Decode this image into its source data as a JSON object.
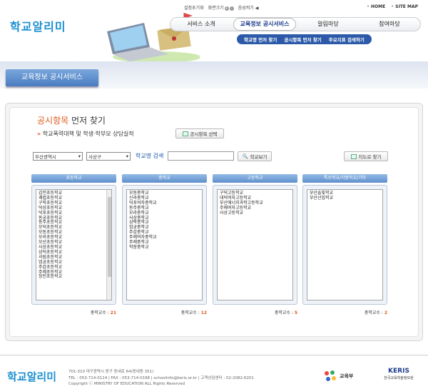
{
  "header": {
    "logo": "학교알리미",
    "util": {
      "settings": "설정초기화",
      "zoom": "화면크기",
      "sound": "음성켜기"
    },
    "toplinks": [
      "HOME",
      "SITE MAP"
    ],
    "nav": [
      "서비스 소개",
      "교육정보 공시서비스",
      "알림마당",
      "참여마당"
    ],
    "subnav": [
      "학교명 먼저 찾기",
      "공시항목 먼저 찾기",
      "주요지표 검색하기"
    ]
  },
  "banner": {
    "title": "교육정보 공시서비스"
  },
  "main": {
    "title_hl": "공시항목",
    "title_rest": " 먼저 찾기",
    "subtitle": "학교폭력대책 및 학생·학부모 상담실적",
    "select_button": "공시항목 선택",
    "city": "부산광역시",
    "gu": "사상구",
    "search_label": "학교명 검색",
    "search_value": "",
    "search_button": "학교보기",
    "map_button": "지도로 찾기"
  },
  "columns": [
    {
      "title": "초등학교",
      "count_label": "총학교수 :",
      "count": "21",
      "schools": [
        "감전초등학교",
        "괘법초등학교",
        "구학초등학교",
        "덕상초등학교",
        "덕포초등학교",
        "동궁초등학교",
        "동주초등학교",
        "모덕초등학교",
        "모동초등학교",
        "모라초등학교",
        "모산초등학교",
        "사상초등학교",
        "삼덕초등학교",
        "서림초등학교",
        "엄궁초등학교",
        "주감초등학교",
        "주례초등학교",
        "창진초등학교"
      ]
    },
    {
      "title": "중학교",
      "count_label": "총학교수 :",
      "count": "12",
      "schools": [
        "모동중학교",
        "신라중학교",
        "덕포여자중학교",
        "동주중학교",
        "모라중학교",
        "사상중학교",
        "삼락중학교",
        "엄궁중학교",
        "주감중학교",
        "주례여자중학교",
        "주례중학교",
        "학장중학교"
      ]
    },
    {
      "title": "고등학교",
      "count_label": "총학교수 :",
      "count": "5",
      "schools": [
        "구덕고등학교",
        "대덕여자고등학교",
        "부산에너지과학고등학교",
        "주례여자고등학교",
        "사상고등학교"
      ]
    },
    {
      "title": "특수학교/각종학교/기타",
      "count_label": "총학교수 :",
      "count": "2",
      "schools": [
        "부산솔빛학교",
        "부산산업학교"
      ]
    }
  ],
  "footer": {
    "logo": "학교알리미",
    "address": "701-310 대구광역시 동구 동내로 64(동내동 351)",
    "contact": "TEL : 053-714-0114 | FAX : 053-714-0198 | schoolinfo@keris.or.kr | 고객상담센터 : 02-2082-6201",
    "copyright": "Copyright ⓒ MINISTRY OF EDUCATION ALL Rights Reserved",
    "moe_label": "교육부",
    "keris_label": "KERIS",
    "keris_sub": "한국교육학술정보원"
  }
}
